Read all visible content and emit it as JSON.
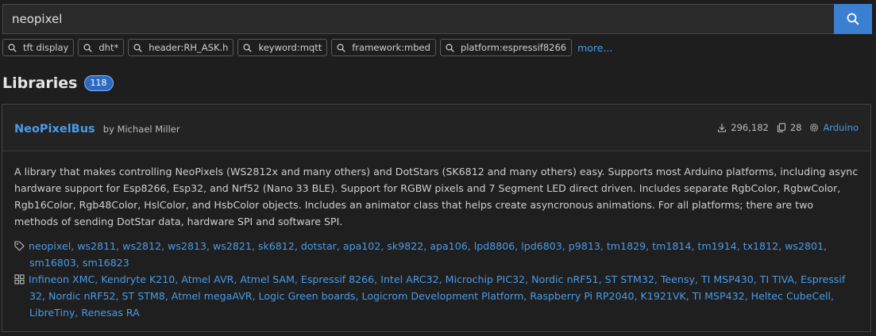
{
  "search": {
    "value": "neopixel"
  },
  "chips": [
    "tft display",
    "dht*",
    "header:RH_ASK.h",
    "keyword:mqtt",
    "framework:mbed",
    "platform:espressif8266"
  ],
  "more_label": "more...",
  "libraries": {
    "title": "Libraries",
    "count": "118"
  },
  "library": {
    "name": "NeoPixelBus",
    "author": "by Michael Miller",
    "downloads": "296,182",
    "examples": "28",
    "framework": "Arduino",
    "description": "A library that makes controlling NeoPixels (WS2812x and many others) and DotStars (SK6812 and many others) easy. Supports most Arduino platforms, including async hardware support for Esp8266, Esp32, and Nrf52 (Nano 33 BLE). Support for RGBW pixels and 7 Segment LED direct driven. Includes separate RgbColor, RgbwColor, Rgb16Color, Rgb48Color, HslColor, and HsbColor objects. Includes an animator class that helps create asyncronous animations. For all platforms; there are two methods of sending DotStar data, hardware SPI and software SPI.",
    "keywords": "neopixel, ws2811, ws2812, ws2813, ws2821, sk6812, dotstar, apa102, sk9822, apa106, lpd8806, lpd6803, p9813, tm1829, tm1814, tm1914, tx1812, ws2801, sm16803, sm16823",
    "platforms": "Infineon XMC, Kendryte K210, Atmel AVR, Atmel SAM, Espressif 8266, Intel ARC32, Microchip PIC32, Nordic nRF51, ST STM32, Teensy, TI MSP430, TI TIVA, Espressif 32, Nordic nRF52, ST STM8, Atmel megaAVR, Logic Green boards, Logicrom Development Platform, Raspberry Pi RP2040, K1921VK, TI MSP432, Heltec CubeCell, LibreTiny, Renesas RA"
  },
  "colors": {
    "accent": "#3b7fd1",
    "link": "#4a9be8",
    "background": "#1e1e1e"
  },
  "icons": {
    "search": "search-icon",
    "chip": "search-icon",
    "downloads": "download-icon",
    "examples": "copy-icon",
    "framework": "gear-icon",
    "keywords": "tag-icon",
    "platforms": "grid-icon"
  }
}
